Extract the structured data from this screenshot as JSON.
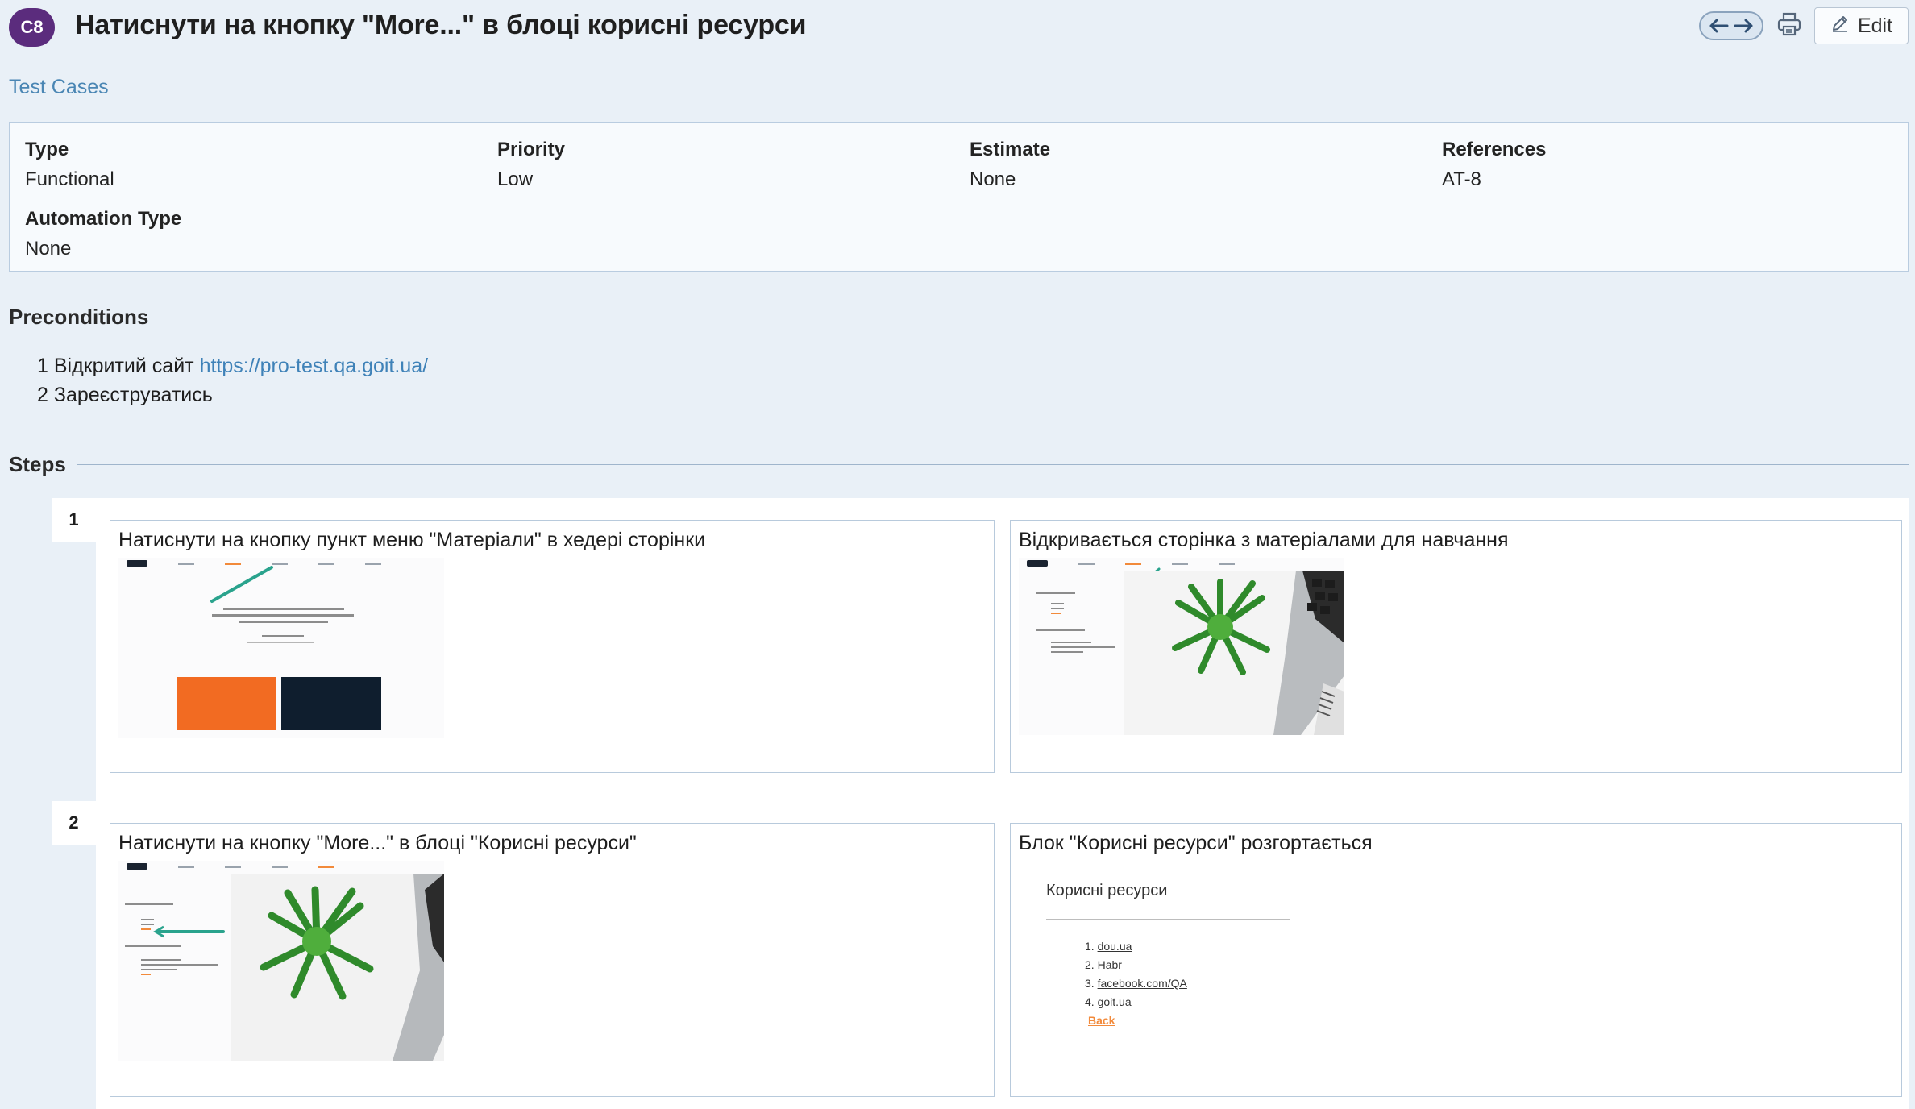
{
  "header": {
    "case_id": "C8",
    "title": "Натиснути на кнопку \"More...\" в блоці корисні ресурси",
    "edit_label": "Edit"
  },
  "breadcrumb": "Test Cases",
  "details": {
    "type_label": "Type",
    "type_value": "Functional",
    "priority_label": "Priority",
    "priority_value": "Low",
    "estimate_label": "Estimate",
    "estimate_value": "None",
    "references_label": "References",
    "references_value": "AT-8",
    "automation_label": "Automation Type",
    "automation_value": "None"
  },
  "preconditions": {
    "title": "Preconditions",
    "line1_prefix": "1 Відкритий сайт",
    "line1_link": "https://pro-test.qa.goit.ua/",
    "line2": "2 Зареєструватись"
  },
  "steps": {
    "title": "Steps",
    "items": [
      {
        "number": "1",
        "action": "Натиснути на кнопку пункт меню \"Матеріали\" в хедері сторінки",
        "expected": "Відкривається сторінка з матеріалами для навчання"
      },
      {
        "number": "2",
        "action": "Натиснути на кнопку \"More...\" в блоці \"Корисні ресурси\"",
        "expected": "Блок \"Корисні ресурси\" розгортається"
      }
    ],
    "screenshot_useful": {
      "heading": "Корисні ресурси",
      "items": [
        "dou.ua",
        "Habr",
        "facebook.com/QA",
        "goit.ua"
      ],
      "back": "Back"
    }
  },
  "colors": {
    "badge": "#5b2c7d",
    "link": "#3f82b8",
    "orange": "#f28a3b",
    "navy": "#0f1e2e"
  }
}
